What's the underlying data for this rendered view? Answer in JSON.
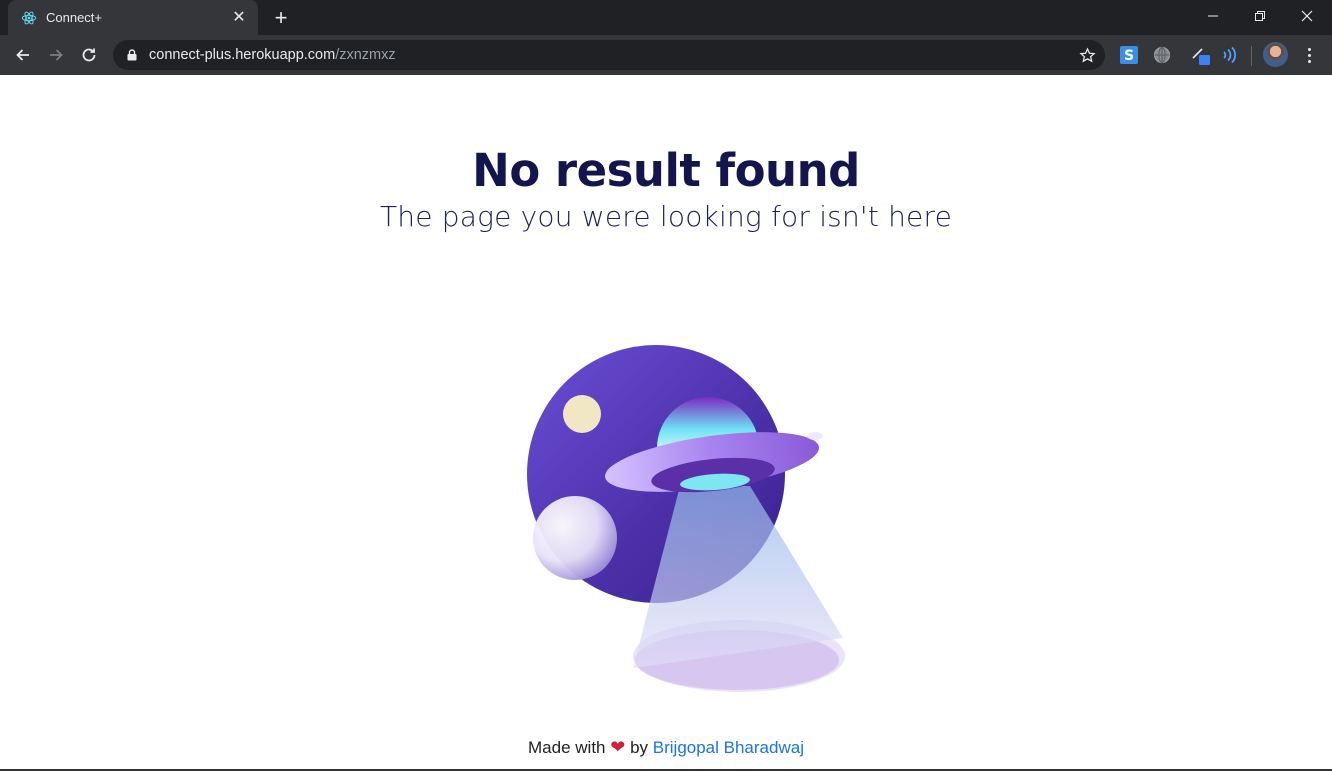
{
  "browser": {
    "tab": {
      "title": "Connect+",
      "favicon": "react-atom-icon",
      "close_glyph": "✕"
    },
    "new_tab_glyph": "+",
    "address": {
      "host": "connect-plus.herokuapp.com",
      "path": "/zxnzmxz"
    },
    "extensions": [
      "s-extension-icon",
      "globe-extension-icon",
      "pen-extension-icon",
      "wifi-extension-icon"
    ],
    "accent": "#35363a"
  },
  "page": {
    "title": "No result found",
    "subtitle": "The page you were looking for isn't here",
    "footer": {
      "made_with": "Made with",
      "heart": "❤",
      "by": "by",
      "author": "Brijgopal Bharadwaj"
    }
  },
  "colors": {
    "heading": "#13154d",
    "planet": "#5a3fbf",
    "link": "#1a73e8"
  }
}
